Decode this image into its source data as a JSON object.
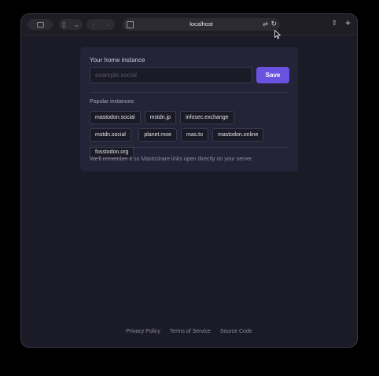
{
  "browser": {
    "url": "localhost",
    "icons": {
      "traffic": "window-controls-icon",
      "sidebar": "sidebar-icon",
      "sidebar_menu": "chevron-down-icon",
      "back": "chevron-left-icon",
      "forward": "chevron-right-icon",
      "site": "site-settings-icon",
      "translate": "translate-icon",
      "reload": "reload-icon",
      "share": "share-icon",
      "new_tab": "plus-icon"
    }
  },
  "card": {
    "title": "Your home instance",
    "input": {
      "value": "",
      "placeholder": "example.social"
    },
    "save_label": "Save",
    "popular_label": "Popular instances:",
    "instances": [
      "mastodon.social",
      "mstdn.jp",
      "infosec.exchange",
      "mstdn.social",
      "planet.moe",
      "mas.to",
      "mastodon.online",
      "fosstodon.org"
    ],
    "note": "We'll remember it so Mastoshare links open directly on your server."
  },
  "footer": {
    "links": [
      "Privacy Policy",
      "Terms of Service",
      "Source Code"
    ]
  },
  "colors": {
    "accent": "#6a52e0",
    "background": "#1b1a27",
    "card": "#252338"
  }
}
